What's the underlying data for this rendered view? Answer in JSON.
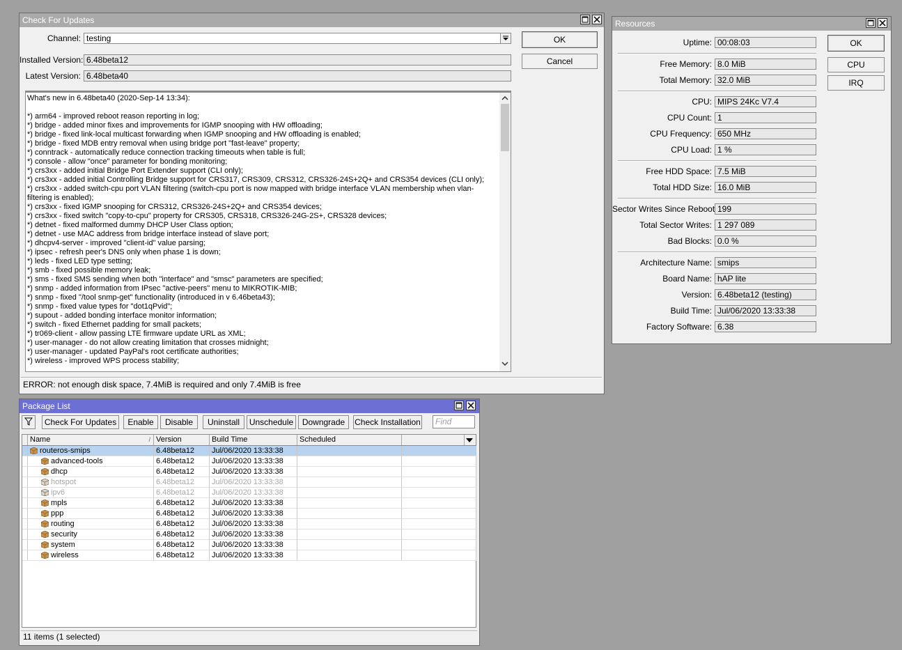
{
  "check_updates": {
    "title": "Check For Updates",
    "channel_label": "Channel:",
    "channel_value": "testing",
    "installed_label": "Installed Version:",
    "installed_value": "6.48beta12",
    "latest_label": "Latest Version:",
    "latest_value": "6.48beta40",
    "ok_label": "OK",
    "cancel_label": "Cancel",
    "changelog": [
      "What's new in 6.48beta40 (2020-Sep-14 13:34):",
      "",
      "*) arm64 - improved reboot reason reporting in log;",
      "*) bridge - added minor fixes and improvements for IGMP snooping with HW offloading;",
      "*) bridge - fixed link-local multicast forwarding when IGMP snooping and HW offloading is enabled;",
      "*) bridge - fixed MDB entry removal when using bridge port \"fast-leave\" property;",
      "*) conntrack - automatically reduce connection tracking timeouts when table is full;",
      "*) console - allow \"once\" parameter for bonding monitoring;",
      "*) crs3xx - added initial Bridge Port Extender support (CLI only);",
      "*) crs3xx - added initial Controlling Bridge support for CRS317, CRS309, CRS312, CRS326-24S+2Q+ and CRS354 devices (CLI only);",
      "*) crs3xx - added switch-cpu port VLAN filtering (switch-cpu port is now mapped with bridge interface VLAN membership when vlan-filtering is enabled);",
      "*) crs3xx - fixed IGMP snooping for CRS312, CRS326-24S+2Q+ and CRS354 devices;",
      "*) crs3xx - fixed switch \"copy-to-cpu\" property for CRS305, CRS318, CRS326-24G-2S+, CRS328 devices;",
      "*) detnet - fixed malformed dummy DHCP User Class option;",
      "*) detnet - use MAC address from bridge interface instead of slave port;",
      "*) dhcpv4-server - improved \"client-id\" value parsing;",
      "*) ipsec - refresh peer's DNS only when phase 1 is down;",
      "*) leds - fixed LED type setting;",
      "*) smb - fixed possible memory leak;",
      "*) sms - fixed SMS sending when both \"interface\" and \"smsc\" parameters are specified;",
      "*) snmp - added information from IPsec \"active-peers\" menu to MIKROTIK-MIB;",
      "*) snmp - fixed \"/tool snmp-get\" functionality (introduced in v 6.46beta43);",
      "*) snmp - fixed value types for \"dot1qPvid\";",
      "*) supout - added bonding interface monitor information;",
      "*) switch - fixed Ethernet padding for small packets;",
      "*) tr069-client - allow passing LTE firmware update URL as XML;",
      "*) user-manager - do not allow creating limitation that crosses midnight;",
      "*) user-manager - updated PayPal's root certificate authorities;",
      "*) wireless - improved WPS process stability;"
    ],
    "status": "ERROR: not enough disk space, 7.4MiB is required and only 7.4MiB is free"
  },
  "resources": {
    "title": "Resources",
    "ok_label": "OK",
    "cpu_label": "CPU",
    "irq_label": "IRQ",
    "fields": [
      {
        "label": "Uptime:",
        "value": "00:08:03"
      },
      {
        "label": "Free Memory:",
        "value": "8.0 MiB"
      },
      {
        "label": "Total Memory:",
        "value": "32.0 MiB"
      },
      {
        "label": "CPU:",
        "value": "MIPS 24Kc V7.4"
      },
      {
        "label": "CPU Count:",
        "value": "1"
      },
      {
        "label": "CPU Frequency:",
        "value": "650 MHz"
      },
      {
        "label": "CPU Load:",
        "value": "1 %"
      },
      {
        "label": "Free HDD Space:",
        "value": "7.5 MiB"
      },
      {
        "label": "Total HDD Size:",
        "value": "16.0 MiB"
      },
      {
        "label": "Sector Writes Since Reboot:",
        "value": "199"
      },
      {
        "label": "Total Sector Writes:",
        "value": "1 297 089"
      },
      {
        "label": "Bad Blocks:",
        "value": "0.0 %"
      },
      {
        "label": "Architecture Name:",
        "value": "smips"
      },
      {
        "label": "Board Name:",
        "value": "hAP lite"
      },
      {
        "label": "Version:",
        "value": "6.48beta12 (testing)"
      },
      {
        "label": "Build Time:",
        "value": "Jul/06/2020 13:33:38"
      },
      {
        "label": "Factory Software:",
        "value": "6.38"
      }
    ]
  },
  "package_list": {
    "title": "Package List",
    "toolbar": {
      "check_for_updates": "Check For Updates",
      "enable": "Enable",
      "disable": "Disable",
      "uninstall": "Uninstall",
      "unschedule": "Unschedule",
      "downgrade": "Downgrade",
      "check_installation": "Check Installation",
      "find_placeholder": "Find"
    },
    "columns": [
      "Name",
      "Version",
      "Build Time",
      "Scheduled"
    ],
    "rows": [
      {
        "name": "routeros-smips",
        "version": "6.48beta12",
        "build": "Jul/06/2020 13:33:38",
        "scheduled": "",
        "selected": true,
        "disabled": false,
        "child": false
      },
      {
        "name": "advanced-tools",
        "version": "6.48beta12",
        "build": "Jul/06/2020 13:33:38",
        "scheduled": "",
        "selected": false,
        "disabled": false,
        "child": true
      },
      {
        "name": "dhcp",
        "version": "6.48beta12",
        "build": "Jul/06/2020 13:33:38",
        "scheduled": "",
        "selected": false,
        "disabled": false,
        "child": true
      },
      {
        "name": "hotspot",
        "version": "6.48beta12",
        "build": "Jul/06/2020 13:33:38",
        "scheduled": "",
        "selected": false,
        "disabled": true,
        "child": true
      },
      {
        "name": "ipv6",
        "version": "6.48beta12",
        "build": "Jul/06/2020 13:33:38",
        "scheduled": "",
        "selected": false,
        "disabled": true,
        "child": true
      },
      {
        "name": "mpls",
        "version": "6.48beta12",
        "build": "Jul/06/2020 13:33:38",
        "scheduled": "",
        "selected": false,
        "disabled": false,
        "child": true
      },
      {
        "name": "ppp",
        "version": "6.48beta12",
        "build": "Jul/06/2020 13:33:38",
        "scheduled": "",
        "selected": false,
        "disabled": false,
        "child": true
      },
      {
        "name": "routing",
        "version": "6.48beta12",
        "build": "Jul/06/2020 13:33:38",
        "scheduled": "",
        "selected": false,
        "disabled": false,
        "child": true
      },
      {
        "name": "security",
        "version": "6.48beta12",
        "build": "Jul/06/2020 13:33:38",
        "scheduled": "",
        "selected": false,
        "disabled": false,
        "child": true
      },
      {
        "name": "system",
        "version": "6.48beta12",
        "build": "Jul/06/2020 13:33:38",
        "scheduled": "",
        "selected": false,
        "disabled": false,
        "child": true
      },
      {
        "name": "wireless",
        "version": "6.48beta12",
        "build": "Jul/06/2020 13:33:38",
        "scheduled": "",
        "selected": false,
        "disabled": false,
        "child": true
      }
    ],
    "status": "11 items (1 selected)"
  },
  "colors": {
    "desktop": "#a0a0a0",
    "active_title": "#6d6fd4",
    "inactive_title": "#aaaaaa",
    "selection": "#b8d3f0",
    "package_icon": "#c8914a"
  }
}
